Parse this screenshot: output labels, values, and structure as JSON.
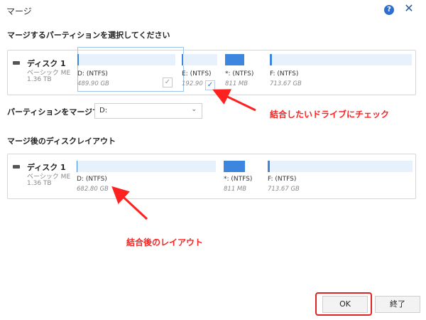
{
  "window": {
    "title": "マージ"
  },
  "section1": {
    "heading": "マージするパーティションを選択してください",
    "disk": {
      "name": "ディスク 1",
      "type": "ベーシック ME",
      "size": "1.36 TB"
    },
    "partitions": [
      {
        "label": "D: (NTFS)",
        "size": "489.90 GB",
        "checked": false,
        "selected": true,
        "fill": 0.01
      },
      {
        "label": "E: (NTFS)",
        "size": "192.90",
        "checked": true,
        "selected": false,
        "fill": 0.02
      },
      {
        "label": "*: (NTFS)",
        "size": "811 MB",
        "checked": false,
        "selected": false,
        "fill": 1.0
      },
      {
        "label": "F: (NTFS)",
        "size": "713.67 GB",
        "checked": false,
        "selected": false,
        "fill": 0.02
      }
    ]
  },
  "merge_to": {
    "label": "パーティションをマージする:",
    "value": "D:"
  },
  "section2": {
    "heading": "マージ後のディスクレイアウト",
    "disk": {
      "name": "ディスク 1",
      "type": "ベーシック ME",
      "size": "1.36 TB"
    },
    "partitions": [
      {
        "label": "D: (NTFS)",
        "size": "682.80 GB",
        "fill": 0.005
      },
      {
        "label": "*: (NTFS)",
        "size": "811 MB",
        "fill": 1.0
      },
      {
        "label": "F: (NTFS)",
        "size": "713.67 GB",
        "fill": 0.02
      }
    ]
  },
  "annotations": {
    "check_note": "結合したいドライブにチェック",
    "layout_note": "結合後のレイアウト"
  },
  "buttons": {
    "ok": "OK",
    "exit": "終了"
  },
  "icons": {
    "help": "?",
    "close": "✕",
    "disk": "disk-icon",
    "dropdown": "⌄",
    "check": "✓"
  },
  "colors": {
    "accent": "#3d86e0",
    "bar_bg": "#e7f1fb",
    "annotation": "#ff2020"
  }
}
